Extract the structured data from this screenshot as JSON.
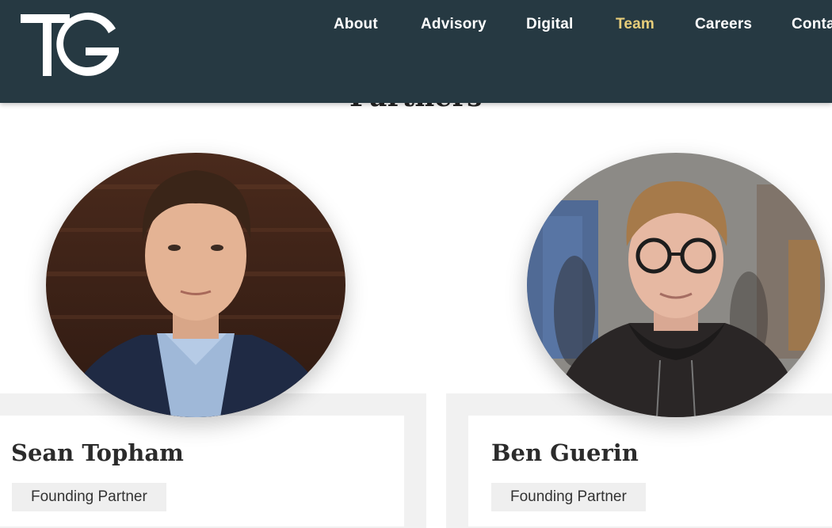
{
  "brand": {
    "logo_text": "TG"
  },
  "nav": {
    "items": [
      {
        "label": "About",
        "active": false
      },
      {
        "label": "Advisory",
        "active": false
      },
      {
        "label": "Digital",
        "active": false
      },
      {
        "label": "Team",
        "active": true
      },
      {
        "label": "Careers",
        "active": false
      },
      {
        "label": "Conta",
        "active": false
      }
    ]
  },
  "section": {
    "title": "Partners"
  },
  "people": [
    {
      "name": "Sean Topham",
      "role": "Founding Partner"
    },
    {
      "name": "Ben Guerin",
      "role": "Founding Partner"
    }
  ],
  "colors": {
    "header_bg": "#263942",
    "nav_text": "#ffffff",
    "nav_active": "#e7cd7a",
    "page_bg": "#ffffff",
    "card_band": "#f1f1f1",
    "badge_bg": "#efefef"
  }
}
